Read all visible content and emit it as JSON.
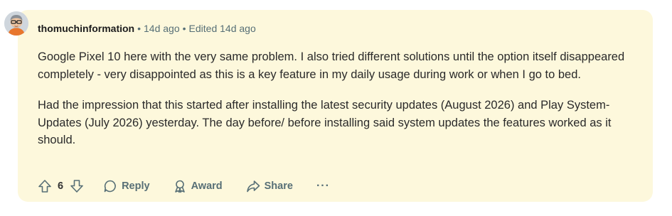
{
  "comment": {
    "author": "thomuchinformation",
    "separator": "•",
    "posted": "14d ago",
    "edited": "Edited 14d ago",
    "paragraphs": [
      "Google Pixel 10 here with the very same problem. I also tried different solutions until the option itself disappeared completely - very disappointed as this is a key feature in my daily usage during work or when I go to bed.",
      "Had the impression that this started after installing the latest security updates (August 2026) and Play System-Updates (July 2026) yesterday. The day before/ before installing said system updates the features worked as it should."
    ],
    "colors": {
      "background": "#fdf8dc",
      "meta": "#576f76"
    }
  },
  "actions": {
    "score": "6",
    "reply_label": "Reply",
    "award_label": "Award",
    "share_label": "Share",
    "more_label": "···",
    "icons": [
      "upvote-icon",
      "downvote-icon",
      "reply-icon",
      "award-icon",
      "share-icon",
      "more-icon"
    ]
  }
}
